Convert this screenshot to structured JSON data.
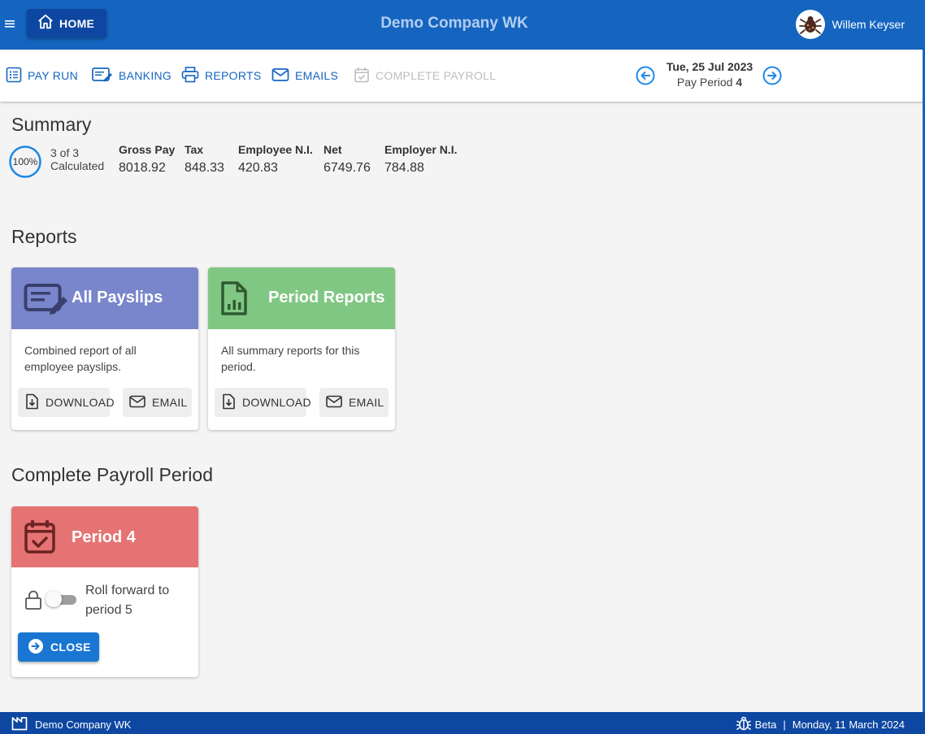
{
  "app": {
    "home_label": "HOME",
    "title": "Demo Company WK",
    "user_name": "Willem Keyser"
  },
  "toolbar": {
    "pay_run": "PAY RUN",
    "banking": "BANKING",
    "reports": "REPORTS",
    "emails": "EMAILS",
    "complete_payroll": "COMPLETE PAYROLL",
    "date": "Tue, 25 Jul 2023",
    "period_label": "Pay Period",
    "period_number": "4"
  },
  "summary": {
    "title": "Summary",
    "progress_percent": "100%",
    "progress_fraction": 1.0,
    "count_text": "3 of 3",
    "status_text": "Calculated",
    "stats": [
      {
        "label": "Gross Pay",
        "value": "8018.92"
      },
      {
        "label": "Tax",
        "value": "848.33"
      },
      {
        "label": "Employee N.I.",
        "value": "420.83"
      },
      {
        "label": "Net",
        "value": "6749.76"
      },
      {
        "label": "Employer N.I.",
        "value": "784.88"
      }
    ]
  },
  "reports": {
    "title": "Reports",
    "cards": [
      {
        "title": "All Payslips",
        "description": "Combined report of all employee payslips.",
        "download_label": "DOWNLOAD",
        "email_label": "EMAIL",
        "color": "#7986cb"
      },
      {
        "title": "Period Reports",
        "description": "All summary reports for this period.",
        "download_label": "DOWNLOAD",
        "email_label": "EMAIL",
        "color": "#81c784"
      }
    ]
  },
  "complete": {
    "title": "Complete Payroll Period",
    "card_title": "Period 4",
    "card_color": "#e57373",
    "roll_text": "Roll forward to period 5",
    "roll_enabled": false,
    "close_label": "CLOSE"
  },
  "footer": {
    "company": "Demo Company WK",
    "beta_label": "Beta",
    "separator": "|",
    "date": "Monday, 11 March 2024"
  },
  "colors": {
    "primary": "#1565c0",
    "primary_dark": "#0d47a1",
    "button": "#1976d2",
    "disabled": "#bdbdbd"
  }
}
